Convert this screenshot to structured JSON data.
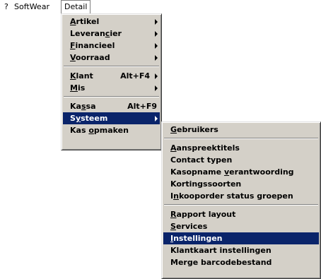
{
  "menubar": {
    "help": "?",
    "softwear": "SoftWear",
    "detail": "Detail"
  },
  "detail_menu": {
    "items": [
      {
        "pre": "",
        "u": "A",
        "post": "rtikel",
        "shortcut": "",
        "submenu": true
      },
      {
        "pre": "Leveran",
        "u": "c",
        "post": "ier",
        "shortcut": "",
        "submenu": true
      },
      {
        "pre": "",
        "u": "F",
        "post": "inancieel",
        "shortcut": "",
        "submenu": true
      },
      {
        "pre": "",
        "u": "V",
        "post": "oorraad",
        "shortcut": "",
        "submenu": true
      },
      {
        "pre": "",
        "u": "K",
        "post": "lant",
        "shortcut": "Alt+F4",
        "submenu": true
      },
      {
        "pre": "",
        "u": "M",
        "post": "is",
        "shortcut": "",
        "submenu": true
      },
      {
        "pre": "Ka",
        "u": "s",
        "post": "sa",
        "shortcut": "Alt+F9",
        "submenu": false
      },
      {
        "pre": "S",
        "u": "y",
        "post": "steem",
        "shortcut": "",
        "submenu": true
      },
      {
        "pre": "Kas ",
        "u": "o",
        "post": "pmaken",
        "shortcut": "",
        "submenu": false
      }
    ]
  },
  "systeem_menu": {
    "items": [
      {
        "pre": "",
        "u": "G",
        "post": "ebruikers"
      },
      {
        "pre": "",
        "u": "A",
        "post": "anspreektitels"
      },
      {
        "pre": "Contact typen",
        "u": "",
        "post": ""
      },
      {
        "pre": "Kasopname ",
        "u": "v",
        "post": "erantwoording"
      },
      {
        "pre": "Kortingssoorten",
        "u": "",
        "post": ""
      },
      {
        "pre": "I",
        "u": "n",
        "post": "kooporder status groepen"
      },
      {
        "pre": "",
        "u": "R",
        "post": "apport layout"
      },
      {
        "pre": "",
        "u": "S",
        "post": "ervices"
      },
      {
        "pre": "",
        "u": "I",
        "post": "nstellingen"
      },
      {
        "pre": "Klantkaart instellingen",
        "u": "",
        "post": ""
      },
      {
        "pre": "Merge barcodebestand",
        "u": "",
        "post": ""
      }
    ]
  }
}
